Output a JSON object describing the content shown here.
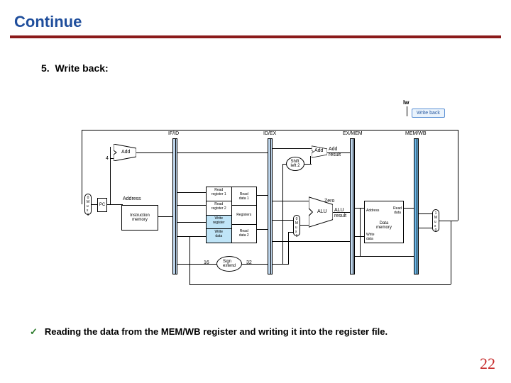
{
  "slide": {
    "title": "Continue",
    "list_number": "5.",
    "subhead": "Write back:",
    "note": "Reading the data from the MEM/WB register and writing it into the register file.",
    "page_number": "22"
  },
  "diagram": {
    "instr_label": "lw",
    "stage_bubble": "Write back",
    "pipe_labels": {
      "ifid": "IF/ID",
      "idex": "ID/EX",
      "exmem": "EX/MEM",
      "memwb": "MEM/WB"
    },
    "blocks": {
      "pc": "PC",
      "add1": "Add",
      "addr": "Address",
      "instr_mem": "Instruction\nmemory",
      "regfile_title": "Registers",
      "read_reg1": "Read\nregister 1",
      "read_reg2": "Read\nregister 2",
      "write_reg": "Write\nregister",
      "write_data": "Write\ndata",
      "read_data1": "Read\ndata 1",
      "read_data2": "Read\ndata 2",
      "sign_ext": "Sign\nextend",
      "shift": "Shift\nleft 2",
      "add2": "Add",
      "add_result": "Add\nresult",
      "alu": "ALU",
      "alu_result": "ALU\nresult",
      "zero": "Zero",
      "dm_title": "Data\nmemory",
      "dm_addr": "Address",
      "dm_rd": "Read\ndata",
      "dm_wd": "Write\ndata"
    },
    "numbers": {
      "four": "4",
      "sixteen": "16",
      "thirtytwo": "32",
      "zero_top": "0",
      "one_bot": "1"
    },
    "mux_labels": {
      "top": "0",
      "mid": "M\nu\nx",
      "bot": "1"
    }
  }
}
